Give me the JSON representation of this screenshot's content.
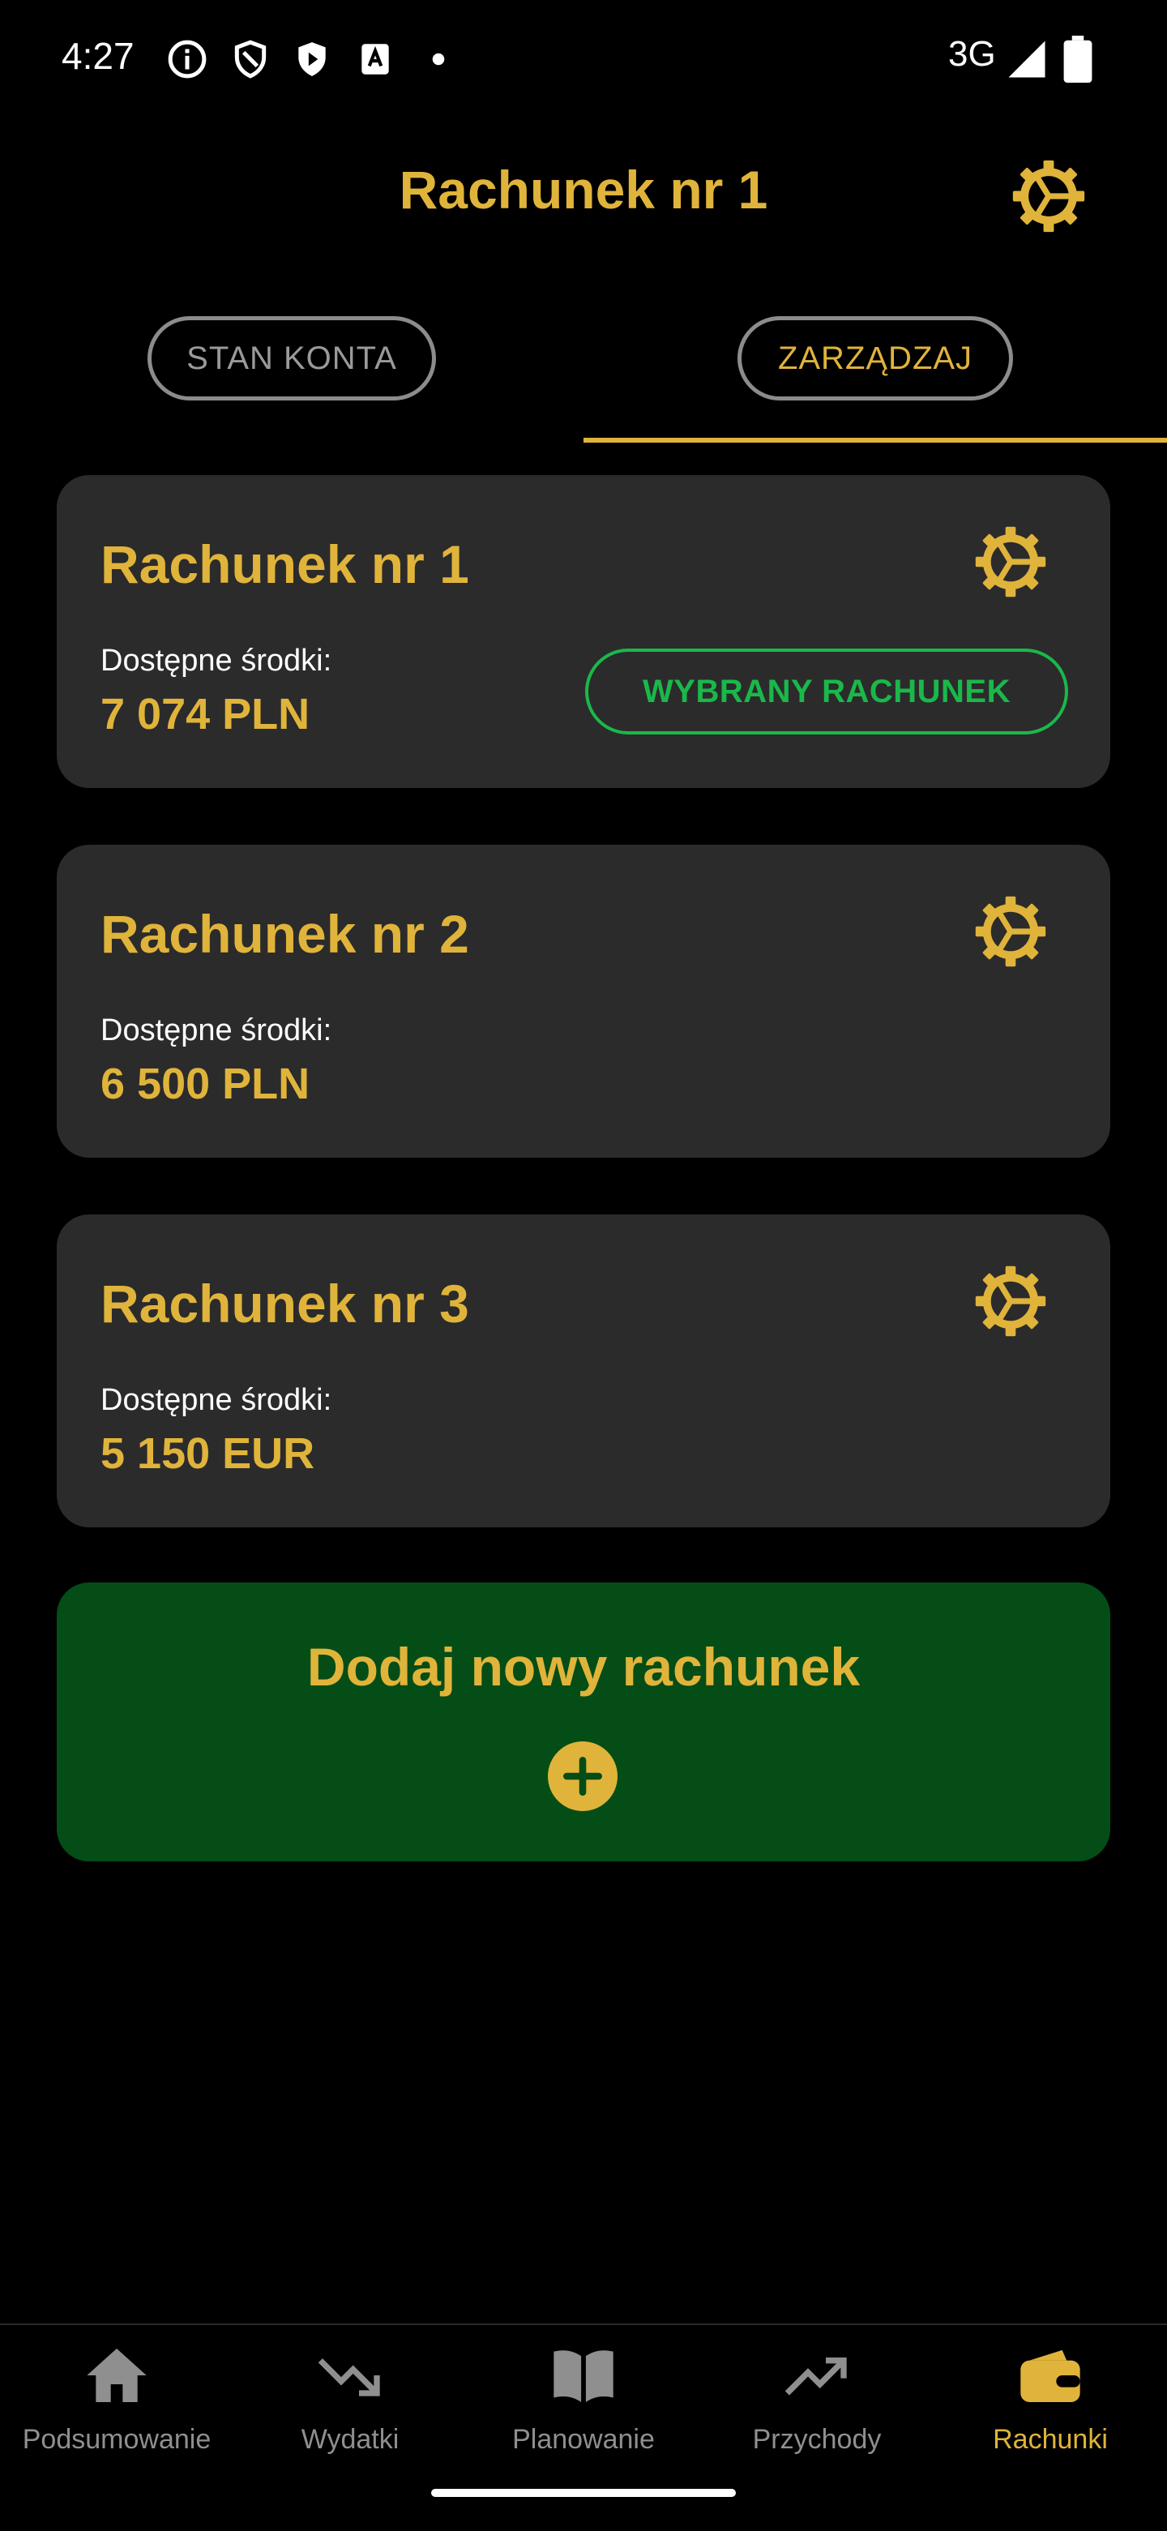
{
  "status": {
    "time": "4:27",
    "network": "3G",
    "icons": [
      "info-icon",
      "shield-icon",
      "play-shield-icon",
      "font-icon",
      "dot-icon",
      "signal-icon",
      "battery-icon"
    ]
  },
  "header": {
    "title": "Rachunek nr 1",
    "settings_icon": "gear-icon"
  },
  "tabs": [
    {
      "label": "STAN KONTA",
      "active": false
    },
    {
      "label": "ZARZĄDZAJ",
      "active": true
    }
  ],
  "accounts": [
    {
      "name": "Rachunek nr 1",
      "label": "Dostępne środki:",
      "amount": "7 074 PLN",
      "badge": "WYBRANY RACHUNEK"
    },
    {
      "name": "Rachunek nr 2",
      "label": "Dostępne środki:",
      "amount": "6 500 PLN"
    },
    {
      "name": "Rachunek nr 3",
      "label": "Dostępne środki:",
      "amount": "5 150 EUR"
    }
  ],
  "add_account": {
    "label": "Dodaj nowy rachunek",
    "icon": "plus-circle-icon"
  },
  "nav": [
    {
      "label": "Podsumowanie",
      "icon": "home-icon",
      "active": false
    },
    {
      "label": "Wydatki",
      "icon": "trending-down-icon",
      "active": false
    },
    {
      "label": "Planowanie",
      "icon": "book-icon",
      "active": false
    },
    {
      "label": "Przychody",
      "icon": "trending-up-icon",
      "active": false
    },
    {
      "label": "Rachunki",
      "icon": "wallet-icon",
      "active": true
    }
  ],
  "colors": {
    "accent": "#e0b43a",
    "card": "#2b2b2c",
    "success": "#1ab84a",
    "add_bg": "#054d16",
    "background": "#000000"
  }
}
